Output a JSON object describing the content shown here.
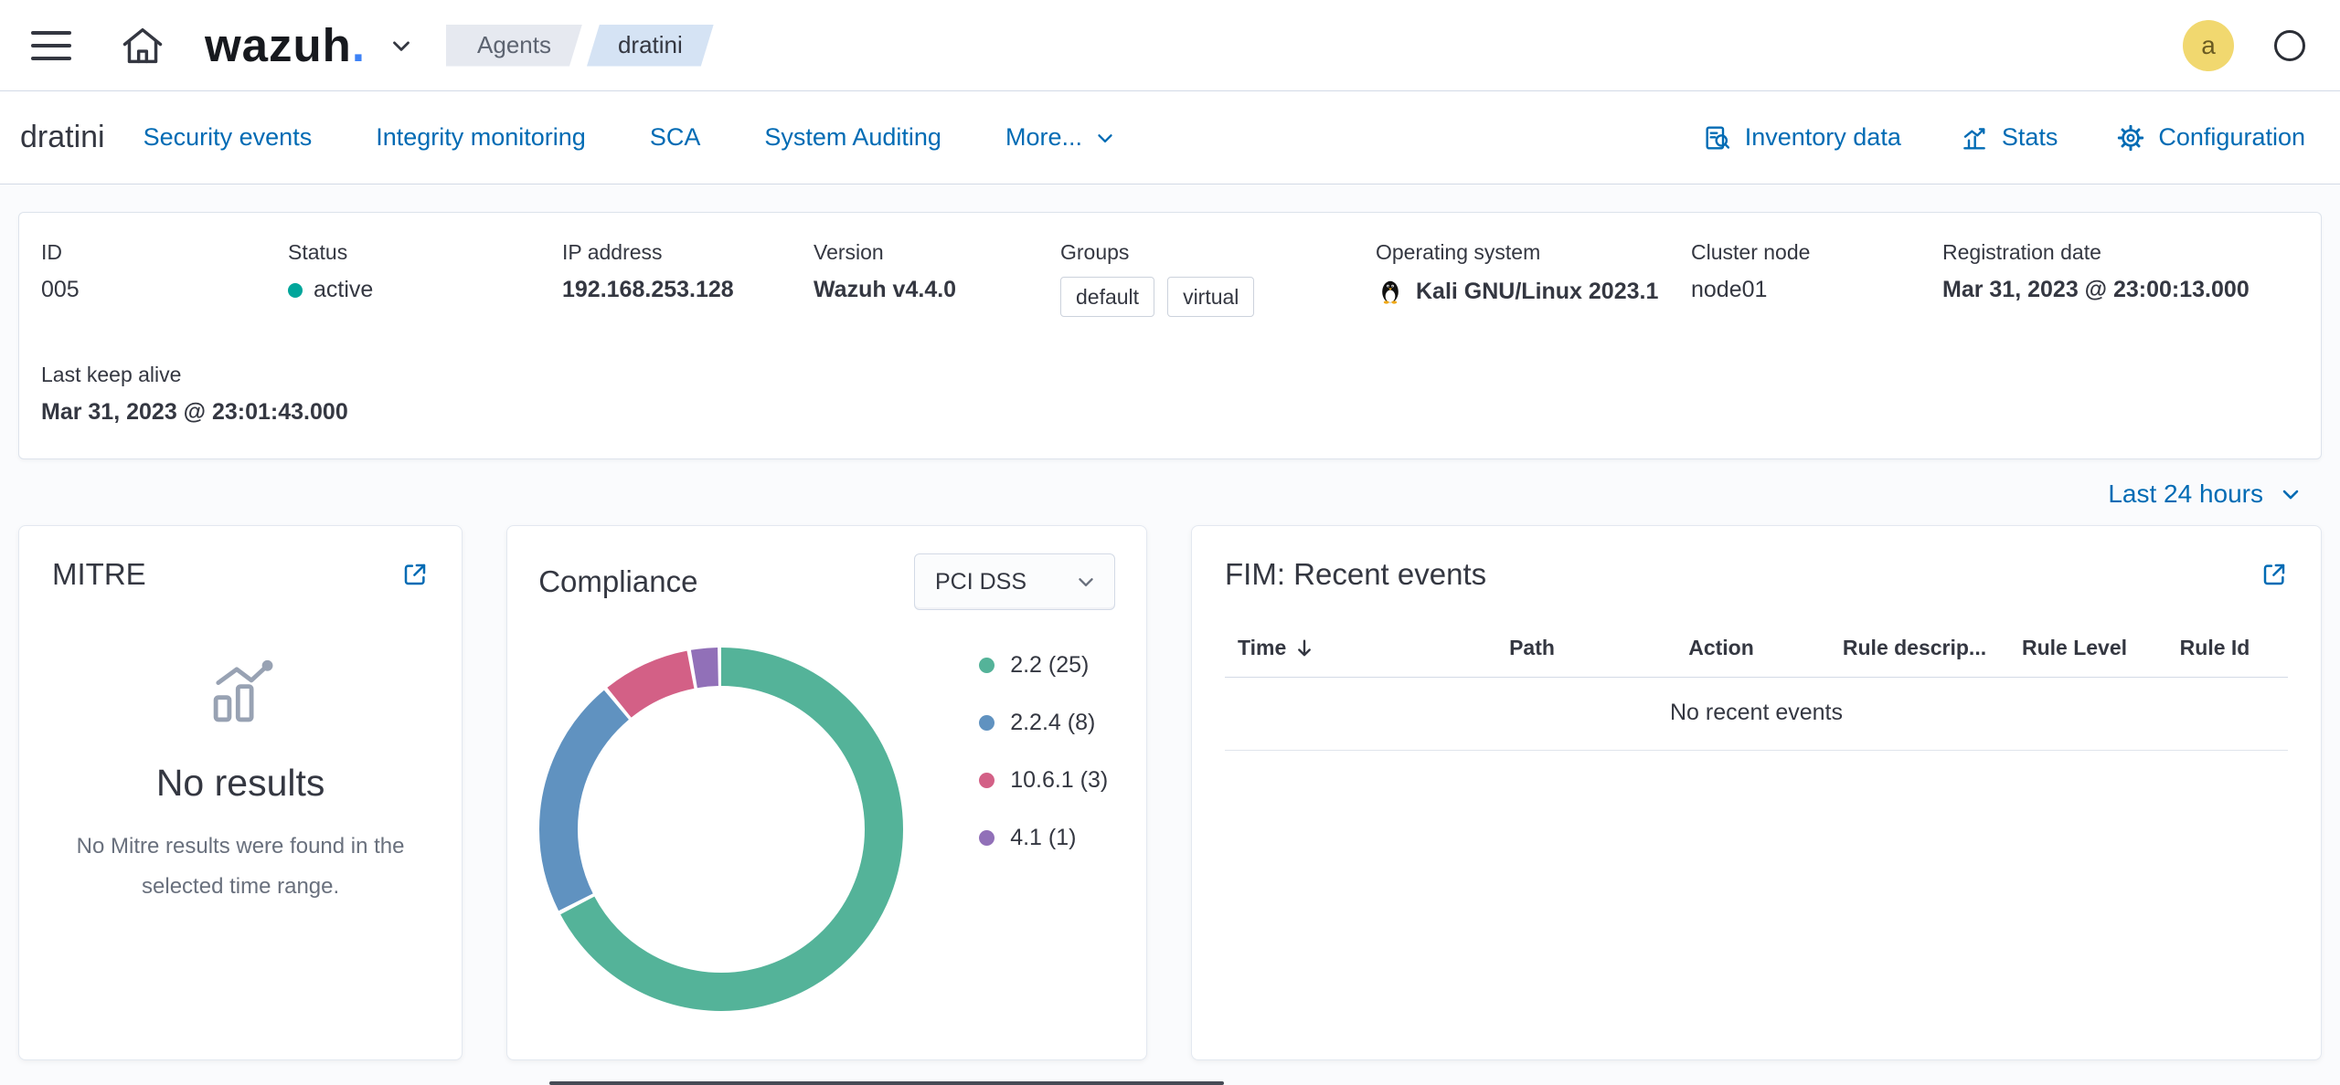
{
  "header": {
    "logo_text": "wazuh",
    "logo_dot": ".",
    "breadcrumbs": [
      {
        "label": "Agents"
      },
      {
        "label": "dratini"
      }
    ],
    "avatar_initial": "a"
  },
  "nav": {
    "agent_title": "dratini",
    "tabs": [
      {
        "label": "Security events"
      },
      {
        "label": "Integrity monitoring"
      },
      {
        "label": "SCA"
      },
      {
        "label": "System Auditing"
      },
      {
        "label": "More..."
      }
    ],
    "actions": [
      {
        "label": "Inventory data"
      },
      {
        "label": "Stats"
      },
      {
        "label": "Configuration"
      }
    ]
  },
  "agent": {
    "id_label": "ID",
    "id": "005",
    "status_label": "Status",
    "status": "active",
    "status_color": "#00A69B",
    "ip_label": "IP address",
    "ip": "192.168.253.128",
    "version_label": "Version",
    "version": "Wazuh v4.4.0",
    "groups_label": "Groups",
    "groups": [
      {
        "name": "default"
      },
      {
        "name": "virtual"
      }
    ],
    "os_label": "Operating system",
    "os": "Kali GNU/Linux 2023.1",
    "cluster_label": "Cluster node",
    "cluster": "node01",
    "registration_label": "Registration date",
    "registration": "Mar 31, 2023 @ 23:00:13.000",
    "keepalive_label": "Last keep alive",
    "keepalive": "Mar 31, 2023 @ 23:01:43.000"
  },
  "time_range": {
    "selected": "Last 24 hours"
  },
  "mitre": {
    "title": "MITRE",
    "empty_title": "No results",
    "empty_message": "No Mitre results were found in the selected time range."
  },
  "compliance": {
    "title": "Compliance",
    "selected_requirement": "PCI DSS"
  },
  "chart_data": {
    "type": "pie",
    "donut": true,
    "title": "Compliance",
    "labels": [
      "2.2",
      "2.2.4",
      "10.6.1",
      "4.1"
    ],
    "values": [
      25,
      8,
      3,
      1
    ],
    "legend": [
      "2.2 (25)",
      "2.2.4 (8)",
      "10.6.1 (3)",
      "4.1 (1)"
    ],
    "colors": [
      "#54B399",
      "#6092C0",
      "#D36086",
      "#9170B8"
    ],
    "legend_position": "right"
  },
  "fim": {
    "title": "FIM: Recent events",
    "columns": [
      {
        "label": "Time",
        "sorted": "desc"
      },
      {
        "label": "Path"
      },
      {
        "label": "Action"
      },
      {
        "label": "Rule descrip..."
      },
      {
        "label": "Rule Level"
      },
      {
        "label": "Rule Id"
      }
    ],
    "empty_message": "No recent events"
  }
}
